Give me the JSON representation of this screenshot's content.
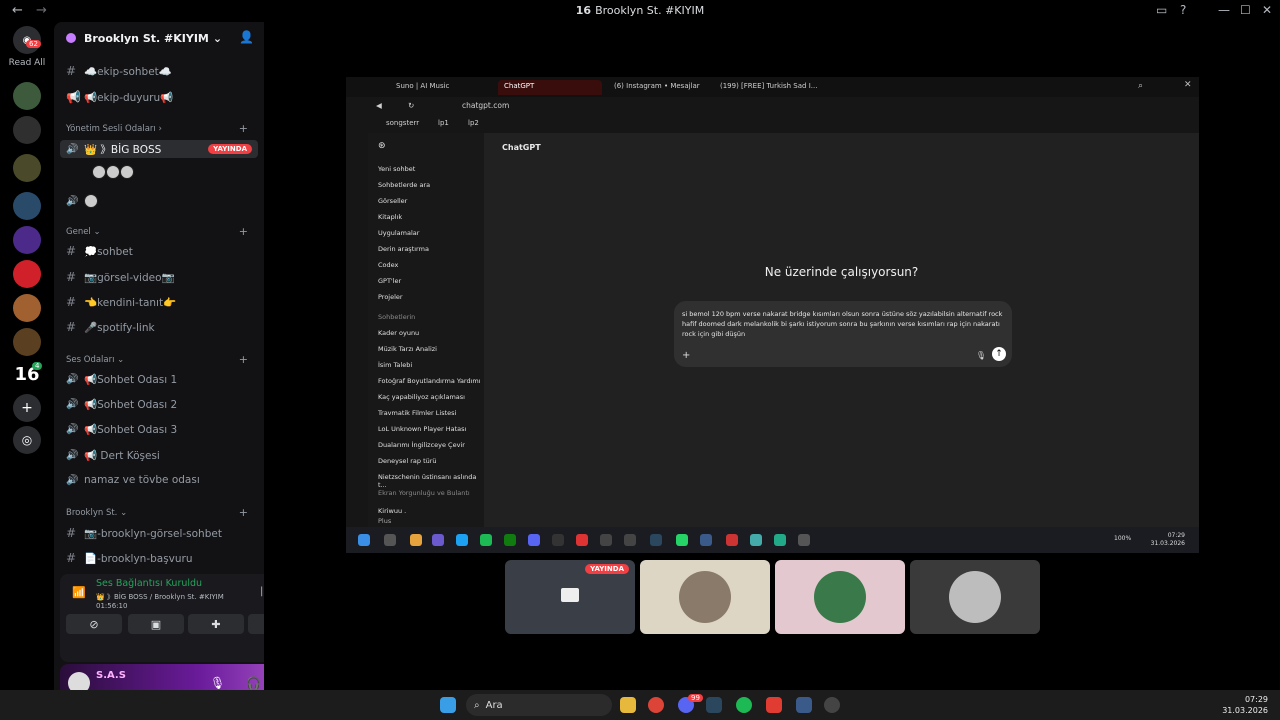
{
  "window": {
    "title_badge": "16",
    "title": "Brooklyn St. #KIYIM"
  },
  "rail": {
    "mention_count": "62",
    "read_all": "Read All",
    "server_16_label": "16",
    "server_badge": "4"
  },
  "server": {
    "name": "Brooklyn St. #KIYIM"
  },
  "channels": {
    "text_top": [
      "☁️ekip-sohbet☁️",
      "📢ekip-duyuru📢"
    ],
    "cat_yonetim": "Yönetim Sesli Odaları",
    "big_boss": "👑 》BİG BOSS",
    "live_label": "YAYINDA",
    "cat_genel": "Genel",
    "genel": [
      "💭sohbet",
      "📷görsel-video📷",
      "👈kendini-tanıt👉",
      "🎤spotify-link"
    ],
    "cat_ses": "Ses Odaları",
    "ses": [
      "📢Sohbet Odası 1",
      "📢Sohbet Odası 2",
      "📢Sohbet Odası 3",
      "📢 Dert Köşesi",
      "namaz ve tövbe odası"
    ],
    "cat_brooklyn": "Brooklyn St.",
    "brooklyn": [
      "📷-brooklyn-görsel-sohbet",
      "📄-brooklyn-başvuru"
    ]
  },
  "voice": {
    "status": "Ses Bağlantısı Kuruldu",
    "where": "👑 》BİG BOSS / Brooklyn St. #KIYIM",
    "elapsed": "01:56:10"
  },
  "user": {
    "name": "S.A.S"
  },
  "browser": {
    "tabs": [
      "Suno | AI Music",
      "ChatGPT",
      "(6) Instagram • Mesajlar",
      "(199) [FREE] Turkish Sad I..."
    ],
    "url": "chatgpt.com",
    "bookmarks": [
      "songsterr",
      "lp1",
      "lp2"
    ]
  },
  "chatgpt": {
    "model": "ChatGPT",
    "menu": [
      "Yeni sohbet",
      "Sohbetlerde ara",
      "Görseller",
      "Kitaplık",
      "Uygulamalar",
      "Derin araştırma",
      "Codex",
      "GPT'ler",
      "Projeler"
    ],
    "history_label": "Sohbetlerin",
    "history": [
      "Kader oyunu",
      "Müzik Tarzı Analizi",
      "İsim Talebi",
      "Fotoğraf Boyutlandırma Yardımı",
      "Kaç yapabiliyoz açıklaması",
      "Travmatik Filmler Listesi",
      "LoL Unknown Player Hatası",
      "Dualarımı İngilizceye Çevir",
      "Deneysel rap türü",
      "Nietzschenin üstinsanı aslında t...",
      "Ekran Yorgunluğu ve Bulantı"
    ],
    "account_name": "Kiriwuu .",
    "account_plan": "Plus",
    "question": "Ne üzerinde çalışıyorsun?",
    "prompt": "si bemol 120 bpm verse nakarat bridge kısımları olsun sonra üstüne söz yazılabilsin alternatif rock hafif doomed dark melankolik bi şarkı istiyorum sonra bu şarkının verse kısımları rap için nakaratı rock için gibi düşün"
  },
  "stream_taskbar": {
    "battery": "100%",
    "time": "07:29",
    "date": "31.03.2026"
  },
  "tiles": {
    "live_label": "YAYINDA"
  },
  "taskbar": {
    "search": "Ara",
    "discord_badge": "99",
    "time": "07:29",
    "date": "31.03.2026"
  }
}
